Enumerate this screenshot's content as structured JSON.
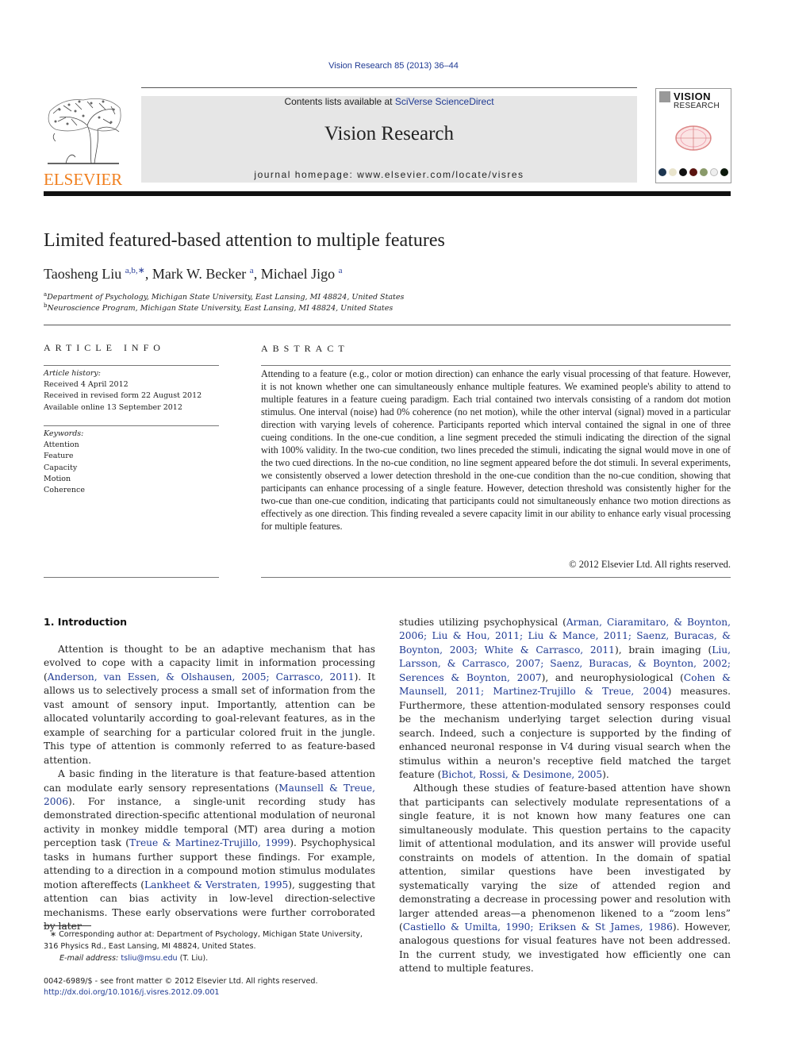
{
  "header": {
    "journal_ref": "Vision Research 85 (2013) 36–44",
    "contents_prefix": "Contents lists available at ",
    "contents_link": "SciVerse ScienceDirect",
    "journal_title": "Vision Research",
    "homepage_prefix": "journal homepage: ",
    "homepage_url": "www.elsevier.com/locate/visres",
    "publisher_logo": "ELSEVIER",
    "cover_title_line1": "VISION",
    "cover_title_line2": "RESEARCH"
  },
  "colors": {
    "link": "#1f3a93",
    "publisher_orange": "#f07f1e",
    "masthead_bg": "#e6e6e6"
  },
  "article": {
    "title": "Limited featured-based attention to multiple features",
    "authors": [
      {
        "name": "Taosheng Liu",
        "marks": "a,b,∗"
      },
      {
        "name": "Mark W. Becker",
        "marks": "a"
      },
      {
        "name": "Michael Jigo",
        "marks": "a"
      }
    ],
    "affiliations": [
      {
        "mark": "a",
        "text": "Department of Psychology, Michigan State University, East Lansing, MI 48824, United States"
      },
      {
        "mark": "b",
        "text": "Neuroscience Program, Michigan State University, East Lansing, MI 48824, United States"
      }
    ]
  },
  "article_info": {
    "heading": "ARTICLE INFO",
    "history_label": "Article history:",
    "history": [
      "Received 4 April 2012",
      "Received in revised form 22 August 2012",
      "Available online 13 September 2012"
    ],
    "keywords_label": "Keywords:",
    "keywords": [
      "Attention",
      "Feature",
      "Capacity",
      "Motion",
      "Coherence"
    ]
  },
  "abstract": {
    "heading": "ABSTRACT",
    "text": "Attending to a feature (e.g., color or motion direction) can enhance the early visual processing of that feature. However, it is not known whether one can simultaneously enhance multiple features. We examined people's ability to attend to multiple features in a feature cueing paradigm. Each trial contained two intervals consisting of a random dot motion stimulus. One interval (noise) had 0% coherence (no net motion), while the other interval (signal) moved in a particular direction with varying levels of coherence. Participants reported which interval contained the signal in one of three cueing conditions. In the one-cue condition, a line segment preceded the stimuli indicating the direction of the signal with 100% validity. In the two-cue condition, two lines preceded the stimuli, indicating the signal would move in one of the two cued directions. In the no-cue condition, no line segment appeared before the dot stimuli. In several experiments, we consistently observed a lower detection threshold in the one-cue condition than the no-cue condition, showing that participants can enhance processing of a single feature. However, detection threshold was consistently higher for the two-cue than one-cue condition, indicating that participants could not simultaneously enhance two motion directions as effectively as one direction. This finding revealed a severe capacity limit in our ability to enhance early visual processing for multiple features.",
    "copyright": "© 2012 Elsevier Ltd. All rights reserved."
  },
  "body": {
    "section_heading": "1. Introduction",
    "p1": {
      "t1": "Attention is thought to be an adaptive mechanism that has evolved to cope with a capacity limit in information processing (",
      "c1": "Anderson, van Essen, & Olshausen, 2005; Carrasco, 2011",
      "t2": "). It allows us to selectively process a small set of information from the vast amount of sensory input. Importantly, attention can be allocated voluntarily according to goal-relevant features, as in the example of searching for a particular colored fruit in the jungle. This type of attention is commonly referred to as feature-based attention."
    },
    "p2": {
      "t1": "A basic finding in the literature is that feature-based attention can modulate early sensory representations (",
      "c1": "Maunsell & Treue, 2006",
      "t2": "). For instance, a single-unit recording study has demonstrated direction-specific attentional modulation of neuronal activity in monkey middle temporal (MT) area during a motion perception task (",
      "c2": "Treue & Martinez-Trujillo, 1999",
      "t3": "). Psychophysical tasks in humans further support these findings. For example, attending to a direction in a compound motion stimulus modulates motion aftereffects (",
      "c3": "Lankheet & Verstraten, 1995",
      "t4": "), suggesting that attention can bias activity in low-level direction-selective mechanisms. These early observations were further corroborated by later"
    },
    "p3": {
      "t1": "studies utilizing psychophysical (",
      "c1": "Arman, Ciaramitaro, & Boynton, 2006; Liu & Hou, 2011; Liu & Mance, 2011; Saenz, Buracas, & Boynton, 2003; White & Carrasco, 2011",
      "t2": "), brain imaging (",
      "c2": "Liu, Larsson, & Carrasco, 2007; Saenz, Buracas, & Boynton, 2002; Serences & Boynton, 2007",
      "t3": "), and neurophysiological (",
      "c3": "Cohen & Maunsell, 2011; Martinez-Trujillo & Treue, 2004",
      "t4": ") measures. Furthermore, these attention-modulated sensory responses could be the mechanism underlying target selection during visual search. Indeed, such a conjecture is supported by the finding of enhanced neuronal response in V4 during visual search when the stimulus within a neuron's receptive field matched the target feature (",
      "c4": "Bichot, Rossi, & Desimone, 2005",
      "t5": ")."
    },
    "p4": {
      "t1": "Although these studies of feature-based attention have shown that participants can selectively modulate representations of a single feature, it is not known how many features one can simultaneously modulate. This question pertains to the capacity limit of attentional modulation, and its answer will provide useful constraints on models of attention. In the domain of spatial attention, similar questions have been investigated by systematically varying the size of attended region and demonstrating a decrease in processing power and resolution with larger attended areas—a phenomenon likened to a “zoom lens” (",
      "c1": "Castiello & Umilta, 1990; Eriksen & St James, 1986",
      "t2": "). However, analogous questions for visual features have not been addressed. In the current study, we investigated how efficiently one can attend to multiple features."
    }
  },
  "footnotes": {
    "corresponding": "∗ Corresponding author at: Department of Psychology, Michigan State University, 316 Physics Rd., East Lansing, MI 48824, United States.",
    "email_label": "E-mail address: ",
    "email": "tsliu@msu.edu",
    "email_suffix": " (T. Liu).",
    "front_matter": "0042-6989/$ - see front matter © 2012 Elsevier Ltd. All rights reserved.",
    "doi": "http://dx.doi.org/10.1016/j.visres.2012.09.001"
  }
}
